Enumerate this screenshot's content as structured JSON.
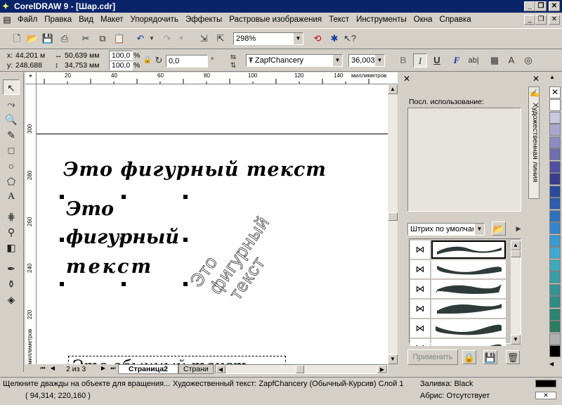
{
  "title": "CorelDRAW 9 - [Шар.cdr]",
  "menu": [
    "Файл",
    "Правка",
    "Вид",
    "Макет",
    "Упорядочить",
    "Эффекты",
    "Растровые изображения",
    "Текст",
    "Инструменты",
    "Окна",
    "Справка"
  ],
  "toolbar": {
    "zoom": "298%"
  },
  "props": {
    "x": "44,201 м",
    "y": "248,688",
    "w": "50,639 мм",
    "h": "34,753 мм",
    "sx": "100,0",
    "sy": "100,0",
    "pct1": "%",
    "pct2": "%",
    "angle": "0,0",
    "deg": "°",
    "font": "ZapfChancery",
    "size": "36,003",
    "bold": "B",
    "italic": "I",
    "underline": "U",
    "font_icon": "F",
    "abl": "ab|"
  },
  "hruler": {
    "ticks": [
      "20",
      "40",
      "60",
      "80",
      "100",
      "120",
      "140"
    ],
    "units": "миллиметров"
  },
  "vruler": {
    "ticks": [
      "300",
      "280",
      "260",
      "240",
      "220"
    ],
    "units": "миллиметров"
  },
  "canvas": {
    "line1": "Это фигурный текст",
    "block": [
      "Это",
      "фигурный",
      "текст"
    ],
    "rotated": [
      "Это",
      "фигурный",
      "текст"
    ],
    "bottom": "Это обычный текст"
  },
  "pagenav": {
    "count": "2 из 3",
    "tab1": "Страница2",
    "tab2": "Страни"
  },
  "docker": {
    "title": "Художественная линия",
    "recent_label": "Посл. использование:",
    "preset": "Штрих по умолчан",
    "apply": "Применить"
  },
  "status": {
    "hint": "Щелкните дважды на объекте для вращения...",
    "coords": "( 94,314; 220,160 )",
    "object": "Художественный текст: ZapfChancery (Обычный-Курсив)  Слой 1",
    "fill": "Заливка: Black",
    "outline": "Абрис: Отсутствует"
  },
  "palette": [
    "#ffffff",
    "#c8c8e0",
    "#a8a8d0",
    "#8c8cc0",
    "#6e6eb0",
    "#5050a0",
    "#3c3c8c",
    "#2a4a9c",
    "#2c5cac",
    "#3070bc",
    "#3486c8",
    "#3a9ad0",
    "#40a8d0",
    "#40a8bc",
    "#3c9ca8",
    "#389494",
    "#308c84",
    "#2c8474",
    "#2c7c64",
    "#b0b0b0",
    "#000000"
  ]
}
